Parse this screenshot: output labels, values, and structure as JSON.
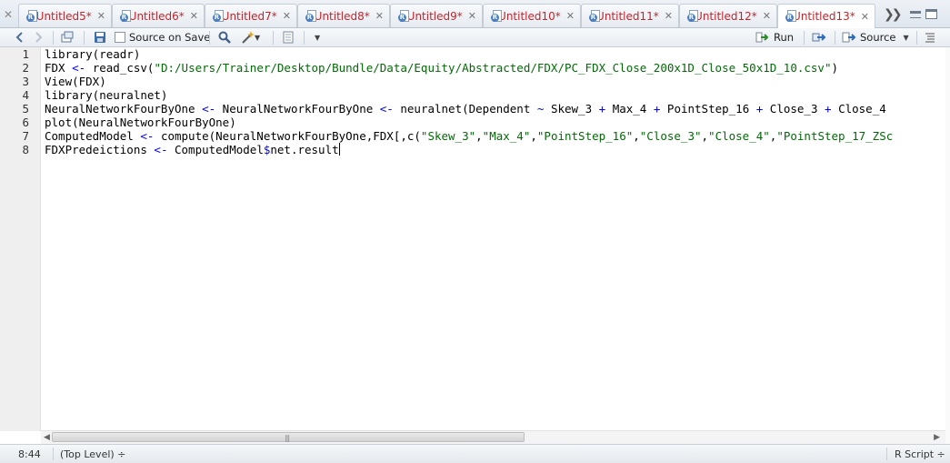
{
  "tabs": [
    {
      "label": "Untitled5*"
    },
    {
      "label": "Untitled6*"
    },
    {
      "label": "Untitled7*"
    },
    {
      "label": "Untitled8*"
    },
    {
      "label": "Untitled9*"
    },
    {
      "label": "Untitled10*"
    },
    {
      "label": "Untitled11*"
    },
    {
      "label": "Untitled12*"
    },
    {
      "label": "Untitled13*"
    }
  ],
  "toolbar": {
    "source_on_save": "Source on Save",
    "run": "Run",
    "source": "Source"
  },
  "editor": {
    "line_numbers": [
      "1",
      "2",
      "3",
      "4",
      "5",
      "6",
      "7",
      "8"
    ],
    "lines": [
      "library(readr)",
      "FDX <- read_csv(\"D:/Users/Trainer/Desktop/Bundle/Data/Equity/Abstracted/FDX/PC_FDX_Close_200x1D_Close_50x1D_10.csv\")",
      "View(FDX)",
      "library(neuralnet)",
      "NeuralNetworkFourByOne <- NeuralNetworkFourByOne <- neuralnet(Dependent ~ Skew_3 + Max_4 + PointStep_16 + Close_3 + Close_4",
      "plot(NeuralNetworkFourByOne)",
      "ComputedModel <- compute(NeuralNetworkFourByOne,FDX[,c(\"Skew_3\",\"Max_4\",\"PointStep_16\",\"Close_3\",\"Close_4\",\"PointStep_17_ZSc",
      "FDXPredeictions <- ComputedModel$net.result"
    ]
  },
  "status": {
    "position": "8:44",
    "scope": "(Top Level) ÷",
    "file_type": "R Script ÷"
  },
  "colors": {
    "tab_label": "#c0262d",
    "keyword": "#0000ff",
    "string": "#036a07"
  }
}
